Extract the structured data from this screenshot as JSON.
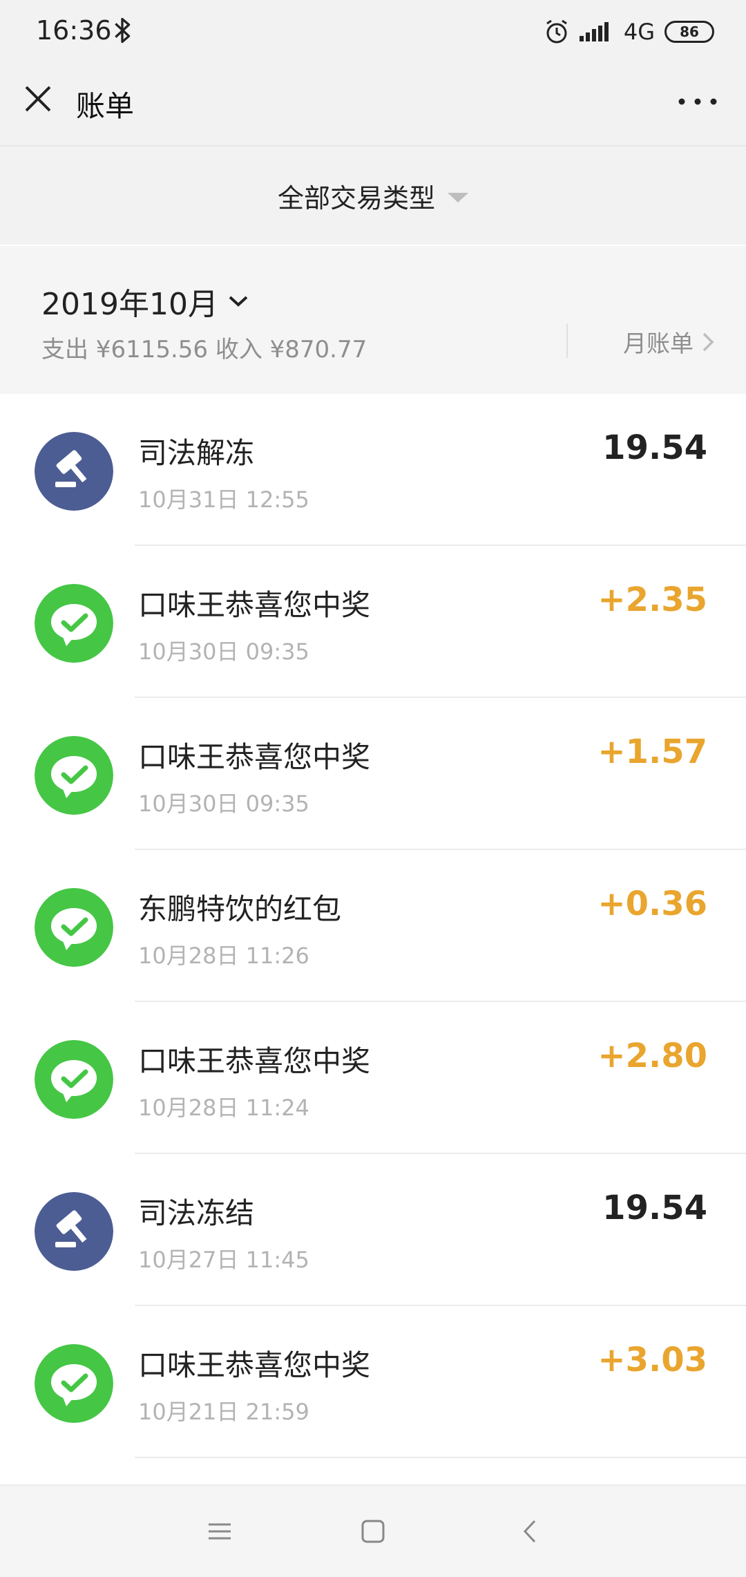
{
  "status_bar": {
    "time": "16:36",
    "network": "4G",
    "battery": "86",
    "icons": [
      "bluetooth-icon",
      "alarm-icon",
      "signal-icon",
      "battery-icon"
    ]
  },
  "header": {
    "title": "账单",
    "close_icon": "close-icon",
    "more_icon": "more-icon"
  },
  "filter": {
    "label": "全部交易类型",
    "icon": "dropdown-triangle-icon"
  },
  "month": {
    "label": "2019年10月",
    "summary": "支出 ¥6115.56 收入 ¥870.77",
    "bill_label": "月账单"
  },
  "colors": {
    "income": "#e9a52e",
    "neutral": "#222222",
    "wechat_green": "#45c645",
    "court_blue": "#4c5d94"
  },
  "transactions": [
    {
      "name": "司法解冻",
      "date": "10月31日 12:55",
      "amount": "19.54",
      "icon": "gavel-icon",
      "kind": "neutral"
    },
    {
      "name": "口味王恭喜您中奖",
      "date": "10月30日 09:35",
      "amount": "+2.35",
      "icon": "wechat-pay-icon",
      "kind": "income"
    },
    {
      "name": "口味王恭喜您中奖",
      "date": "10月30日 09:35",
      "amount": "+1.57",
      "icon": "wechat-pay-icon",
      "kind": "income"
    },
    {
      "name": "东鹏特饮的红包",
      "date": "10月28日 11:26",
      "amount": "+0.36",
      "icon": "wechat-pay-icon",
      "kind": "income"
    },
    {
      "name": "口味王恭喜您中奖",
      "date": "10月28日 11:24",
      "amount": "+2.80",
      "icon": "wechat-pay-icon",
      "kind": "income"
    },
    {
      "name": "司法冻结",
      "date": "10月27日 11:45",
      "amount": "19.54",
      "icon": "gavel-icon",
      "kind": "neutral"
    },
    {
      "name": "口味王恭喜您中奖",
      "date": "10月21日 21:59",
      "amount": "+3.03",
      "icon": "wechat-pay-icon",
      "kind": "income"
    }
  ],
  "nav": {
    "icons": [
      "menu-icon",
      "home-icon",
      "back-icon"
    ]
  }
}
